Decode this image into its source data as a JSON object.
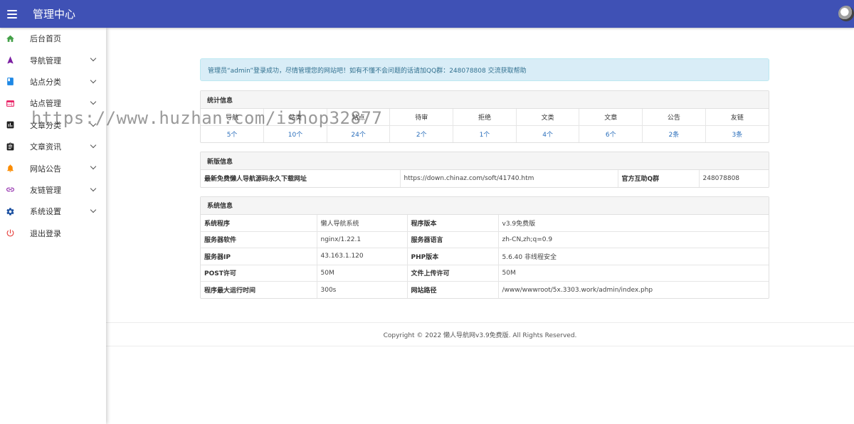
{
  "header": {
    "title": "管理中心",
    "menu_icon": "hamburger-icon",
    "avatar_icon": "user-avatar"
  },
  "sidebar": {
    "items": [
      {
        "label": "后台首页",
        "icon": "home-icon",
        "color": "#43a047",
        "expandable": false
      },
      {
        "label": "导航管理",
        "icon": "navigation-icon",
        "color": "#7b1fa2",
        "expandable": true
      },
      {
        "label": "站点分类",
        "icon": "book-icon",
        "color": "#1e88e5",
        "expandable": true
      },
      {
        "label": "站点管理",
        "icon": "web-icon",
        "color": "#e91e63",
        "expandable": true
      },
      {
        "label": "文章分类",
        "icon": "bar-chart-icon",
        "color": "#212121",
        "expandable": true
      },
      {
        "label": "文章资讯",
        "icon": "clipboard-icon",
        "color": "#212121",
        "expandable": true
      },
      {
        "label": "网站公告",
        "icon": "bell-icon",
        "color": "#fb8c00",
        "expandable": true
      },
      {
        "label": "友链管理",
        "icon": "link-icon",
        "color": "#8e24aa",
        "expandable": true
      },
      {
        "label": "系统设置",
        "icon": "gear-icon",
        "color": "#1a4fa0",
        "expandable": true
      },
      {
        "label": "退出登录",
        "icon": "power-icon",
        "color": "#e53935",
        "expandable": false
      }
    ]
  },
  "alert": {
    "text": "管理员“admin”登录成功，尽情管理您的网站吧！如有不懂不会问题的话请加QQ群：248078808 交流获取帮助"
  },
  "stats": {
    "title": "统计信息",
    "headers": [
      "导航",
      "站类",
      "站点",
      "待审",
      "拒绝",
      "文类",
      "文章",
      "公告",
      "友链"
    ],
    "values": [
      "5个",
      "10个",
      "24个",
      "2个",
      "1个",
      "4个",
      "6个",
      "2条",
      "3条"
    ]
  },
  "version": {
    "title": "新版信息",
    "label1": "最新免费懒人导航源码永久下载网址",
    "url": "https://down.chinaz.com/soft/41740.htm",
    "label2": "官方互助Q群",
    "qq": "248078808"
  },
  "system": {
    "title": "系统信息",
    "rows": [
      {
        "k1": "系统程序",
        "v1": "懒人导航系统",
        "k2": "程序版本",
        "v2": "v3.9免费版"
      },
      {
        "k1": "服务器软件",
        "v1": "nginx/1.22.1",
        "k2": "服务器语言",
        "v2": "zh-CN,zh;q=0.9"
      },
      {
        "k1": "服务器IP",
        "v1": "43.163.1.120",
        "k2": "PHP版本",
        "v2": "5.6.40 非线程安全"
      },
      {
        "k1": "POST许可",
        "v1": "50M",
        "k2": "文件上传许可",
        "v2": "50M"
      },
      {
        "k1": "程序最大运行时间",
        "v1": "300s",
        "k2": "网站路径",
        "v2": "/www/wwwroot/5x.3303.work/admin/index.php"
      }
    ]
  },
  "footer": {
    "text": "Copyright © 2022 懒人导航网v3.9免费版. All Rights Reserved."
  },
  "watermark": {
    "text": "https://www.huzhan.com/ishop32877"
  },
  "colors": {
    "header": "#3f51b5",
    "alert_bg": "#d9edf7",
    "alert_text": "#31708f",
    "link": "#2a6ebb"
  }
}
